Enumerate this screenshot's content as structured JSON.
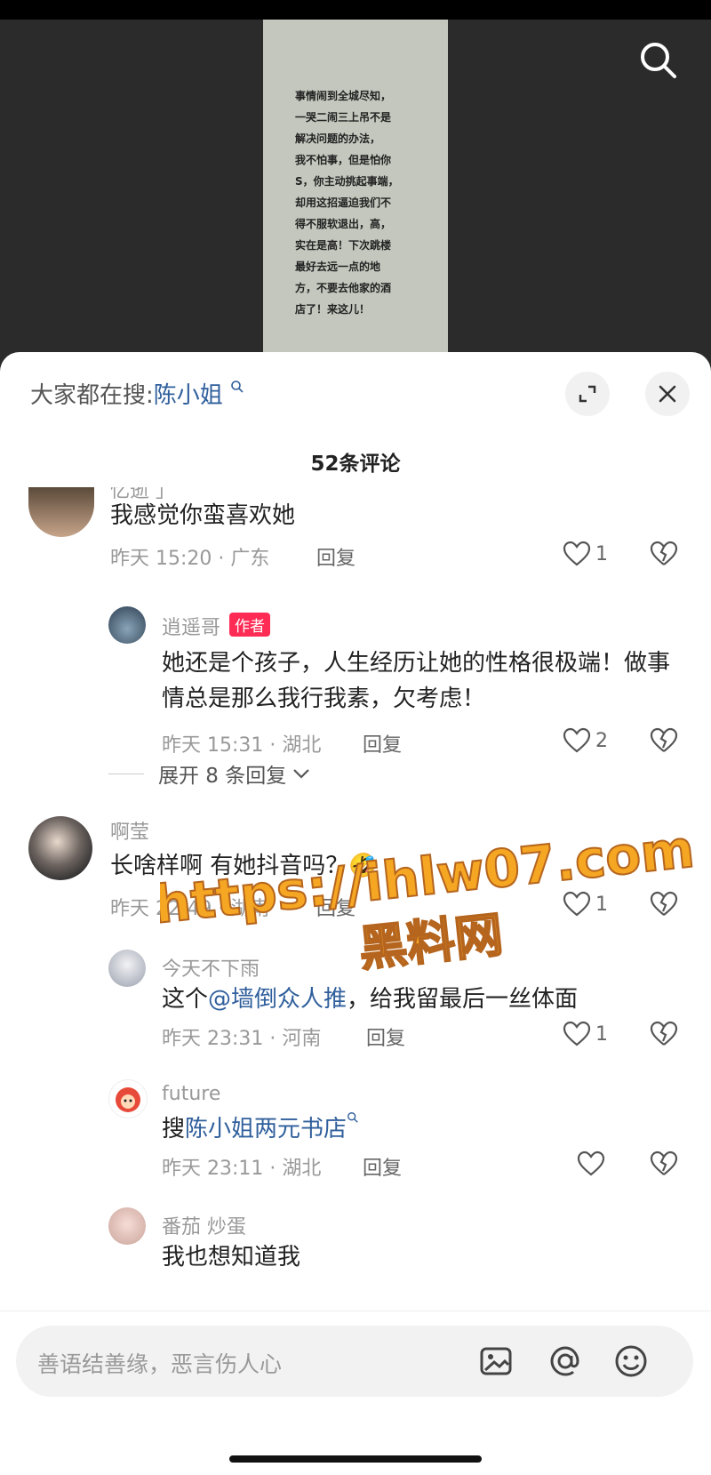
{
  "video": {
    "overlay_text": "事情闹到全城尽知，\n一哭二闹三上吊不是\n解决问题的办法，\n我不怕事，但是怕你\nS，你主动挑起事端，\n却用这招逼迫我们不\n得不服软退出，高，\n实在是高！下次跳楼\n最好去远一点的地\n方，不要去他家的酒\n店了！来这儿！"
  },
  "sheet": {
    "hot_search_prefix": "大家都在搜:",
    "hot_search_term": "陈小姐",
    "comment_count": "52条评论"
  },
  "comments": [
    {
      "user": "忆逝 」",
      "text": "我感觉你蛮喜欢她",
      "time": "昨天 15:20 · 广东",
      "reply": "回复",
      "likes": "1",
      "replies": [
        {
          "user": "逍遥哥",
          "badge": "作者",
          "text": "她还是个孩子，人生经历让她的性格很极端！做事情总是那么我行我素，欠考虑！",
          "time": "昨天 15:31 · 湖北",
          "reply": "回复",
          "likes": "2"
        }
      ],
      "expand": "展开 8 条回复"
    },
    {
      "user": "啊莹",
      "text": "长啥样啊 有她抖音吗？🤣",
      "time": "昨天 22:49 · 湖南",
      "reply": "回复",
      "likes": "1",
      "replies": [
        {
          "user": "今天不下雨",
          "text_prefix": "这个",
          "mention": "@墙倒众人推",
          "text_suffix": "，给我留最后一丝体面",
          "time": "昨天 23:31 · 河南",
          "reply": "回复",
          "likes": "1"
        },
        {
          "user": "future",
          "text_prefix": "搜",
          "link": "陈小姐两元书店",
          "time": "昨天 23:11 · 湖北",
          "reply": "回复"
        },
        {
          "user": "番茄 炒蛋",
          "text": "我也想知道我"
        }
      ]
    }
  ],
  "watermark": {
    "line1": "https://ihlw07.com",
    "line2": "黑料网"
  },
  "input": {
    "placeholder": "善语结善缘，恶言伤人心"
  },
  "colors": {
    "link": "#2f5f9c",
    "author_badge": "#fe2c55",
    "watermark": "#f5a623"
  }
}
